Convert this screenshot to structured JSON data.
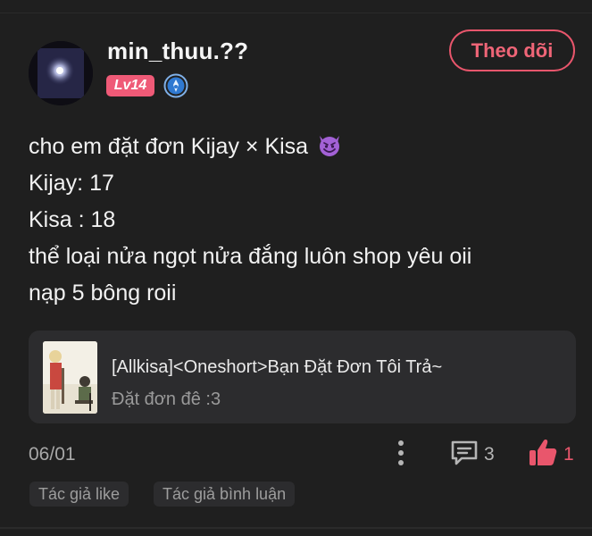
{
  "user": {
    "name": "min_thuu.??",
    "level": "Lv14",
    "follow_label": "Theo dõi"
  },
  "post": {
    "lines": [
      "cho em đặt đơn Kijay × Kisa",
      "Kijay: 17",
      "Kisa : 18",
      "thể loại nửa ngọt nửa đắng luôn shop yêu oii",
      "nạp 5 bông roii"
    ],
    "emoji": "smiling-devil-icon",
    "date": "06/01"
  },
  "story": {
    "title": "[Allkisa]<Oneshort>Bạn Đặt Đơn Tôi Trả~",
    "subtitle": "Đặt đơn đê :3"
  },
  "actions": {
    "comment_count": "3",
    "like_count": "1"
  },
  "tags": [
    "Tác giả like",
    "Tác giả bình luận"
  ],
  "colors": {
    "background": "#1f1f1f",
    "accent": "#e9566c",
    "card": "#2c2c2e"
  }
}
